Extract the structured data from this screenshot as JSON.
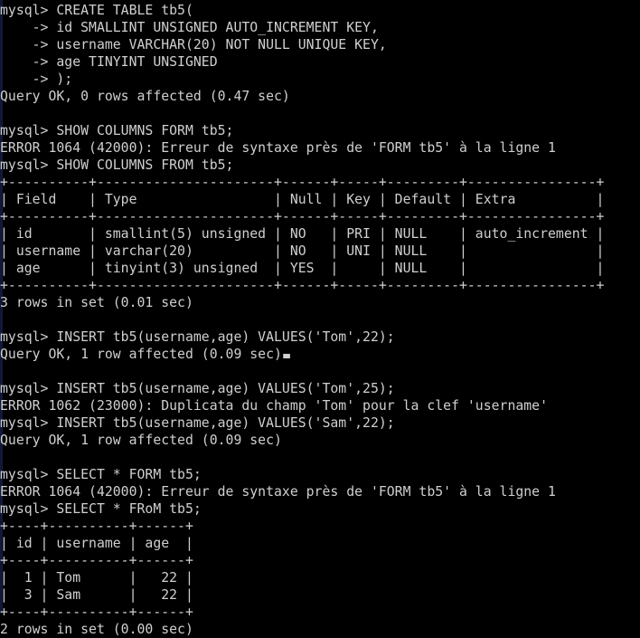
{
  "terminal": {
    "title": "mysql-client-session",
    "colors": {
      "background": "#000000",
      "foreground": "#cfcfcf",
      "left_edge": "#10183a",
      "cursor": "#cfcfcf"
    },
    "prompt": "mysql>",
    "continuation_prompt": "    ->",
    "cursor": {
      "shape": "block-underline",
      "line_index": 15,
      "column": 37
    },
    "lines": [
      {
        "text": "mysql> CREATE TABLE tb5("
      },
      {
        "text": "    -> id SMALLINT UNSIGNED AUTO_INCREMENT KEY,"
      },
      {
        "text": "    -> username VARCHAR(20) NOT NULL UNIQUE KEY,"
      },
      {
        "text": "    -> age TINYINT UNSIGNED"
      },
      {
        "text": "    -> );"
      },
      {
        "text": "Query OK, 0 rows affected (0.47 sec)"
      },
      {
        "text": ""
      },
      {
        "text": "mysql> SHOW COLUMNS FORM tb5;"
      },
      {
        "text": "ERROR 1064 (42000): Erreur de syntaxe près de 'FORM tb5' à la ligne 1"
      },
      {
        "text": "mysql> SHOW COLUMNS FROM tb5;"
      },
      {
        "text": "+----------+----------------------+------+-----+---------+----------------+"
      },
      {
        "text": "| Field    | Type                 | Null | Key | Default | Extra          |"
      },
      {
        "text": "+----------+----------------------+------+-----+---------+----------------+"
      },
      {
        "text": "| id       | smallint(5) unsigned | NO   | PRI | NULL    | auto_increment |"
      },
      {
        "text": "| username | varchar(20)          | NO   | UNI | NULL    |                |"
      },
      {
        "text": "| age      | tinyint(3) unsigned  | YES  |     | NULL    |                |"
      },
      {
        "text": "+----------+----------------------+------+-----+---------+----------------+"
      },
      {
        "text": "3 rows in set (0.01 sec)"
      },
      {
        "text": ""
      },
      {
        "text": "mysql> INSERT tb5(username,age) VALUES('Tom',22);"
      },
      {
        "text": "Query OK, 1 row affected (0.09 sec)",
        "cursor_after": true
      },
      {
        "text": ""
      },
      {
        "text": "mysql> INSERT tb5(username,age) VALUES('Tom',25);"
      },
      {
        "text": "ERROR 1062 (23000): Duplicata du champ 'Tom' pour la clef 'username'"
      },
      {
        "text": "mysql> INSERT tb5(username,age) VALUES('Sam',22);"
      },
      {
        "text": "Query OK, 1 row affected (0.09 sec)"
      },
      {
        "text": ""
      },
      {
        "text": "mysql> SELECT * FORM tb5;"
      },
      {
        "text": "ERROR 1064 (42000): Erreur de syntaxe près de 'FORM tb5' à la ligne 1"
      },
      {
        "text": "mysql> SELECT * FRoM tb5;"
      },
      {
        "text": "+----+----------+------+"
      },
      {
        "text": "| id | username | age  |"
      },
      {
        "text": "+----+----------+------+"
      },
      {
        "text": "|  1 | Tom      |   22 |"
      },
      {
        "text": "|  3 | Sam      |   22 |"
      },
      {
        "text": "+----+----------+------+"
      },
      {
        "text": "2 rows in set (0.00 sec)"
      }
    ]
  },
  "session_content": {
    "statements": [
      {
        "sql": "CREATE TABLE tb5( id SMALLINT UNSIGNED AUTO_INCREMENT KEY, username VARCHAR(20) NOT NULL UNIQUE KEY, age TINYINT UNSIGNED );",
        "result": "Query OK, 0 rows affected (0.47 sec)",
        "status": "ok"
      },
      {
        "sql": "SHOW COLUMNS FORM tb5;",
        "result": "ERROR 1064 (42000): Erreur de syntaxe près de 'FORM tb5' à la ligne 1",
        "status": "error",
        "error_code": "1064",
        "sql_state": "42000"
      },
      {
        "sql": "SHOW COLUMNS FROM tb5;",
        "result": "3 rows in set (0.01 sec)",
        "status": "ok"
      },
      {
        "sql": "INSERT tb5(username,age) VALUES('Tom',22);",
        "result": "Query OK, 1 row affected (0.09 sec)",
        "status": "ok"
      },
      {
        "sql": "INSERT tb5(username,age) VALUES('Tom',25);",
        "result": "ERROR 1062 (23000): Duplicata du champ 'Tom' pour la clef 'username'",
        "status": "error",
        "error_code": "1062",
        "sql_state": "23000"
      },
      {
        "sql": "INSERT tb5(username,age) VALUES('Sam',22);",
        "result": "Query OK, 1 row affected (0.09 sec)",
        "status": "ok"
      },
      {
        "sql": "SELECT * FORM tb5;",
        "result": "ERROR 1064 (42000): Erreur de syntaxe près de 'FORM tb5' à la ligne 1",
        "status": "error",
        "error_code": "1064",
        "sql_state": "42000"
      },
      {
        "sql": "SELECT * FRoM tb5;",
        "result": "2 rows in set (0.00 sec)",
        "status": "ok"
      }
    ],
    "columns_table": {
      "headers": [
        "Field",
        "Type",
        "Null",
        "Key",
        "Default",
        "Extra"
      ],
      "rows": [
        [
          "id",
          "smallint(5) unsigned",
          "NO",
          "PRI",
          "NULL",
          "auto_increment"
        ],
        [
          "username",
          "varchar(20)",
          "NO",
          "UNI",
          "NULL",
          ""
        ],
        [
          "age",
          "tinyint(3) unsigned",
          "YES",
          "",
          "NULL",
          ""
        ]
      ],
      "footer": "3 rows in set (0.01 sec)"
    },
    "select_table": {
      "headers": [
        "id",
        "username",
        "age"
      ],
      "rows": [
        [
          "1",
          "Tom",
          "22"
        ],
        [
          "3",
          "Sam",
          "22"
        ]
      ],
      "footer": "2 rows in set (0.00 sec)"
    }
  }
}
